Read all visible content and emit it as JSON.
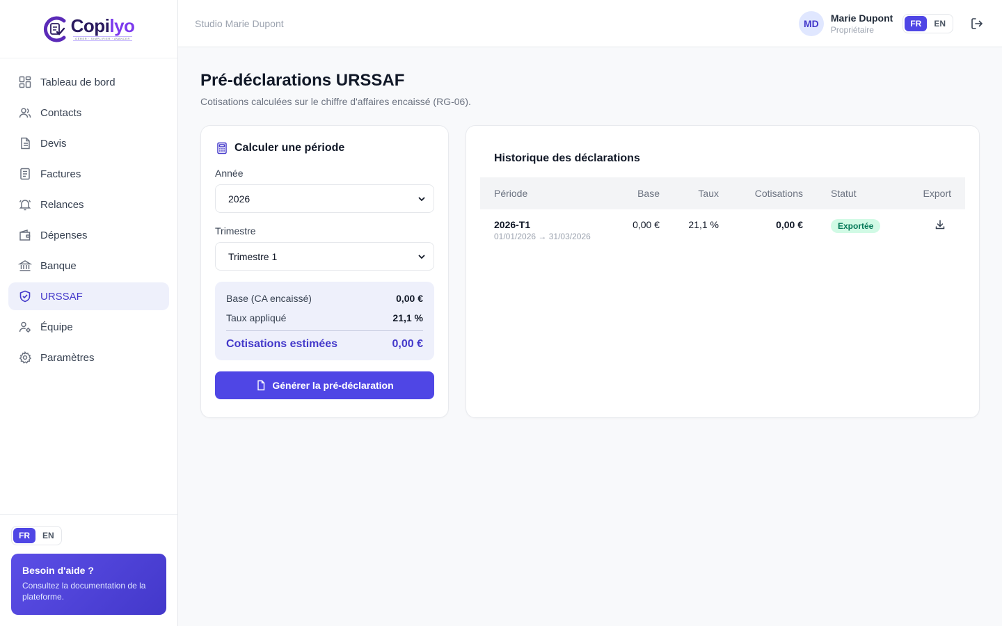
{
  "brand": {
    "name_part1": "Copi",
    "name_part2": "lyo",
    "tagline": "GÉRER · SIMPLIFIER · AVANCER"
  },
  "header": {
    "studio": "Studio Marie Dupont",
    "avatar": "MD",
    "user_name": "Marie Dupont",
    "user_role": "Propriétaire",
    "lang_fr": "FR",
    "lang_en": "EN"
  },
  "sidebar": {
    "items": [
      {
        "label": "Tableau de bord",
        "icon": "grid-icon"
      },
      {
        "label": "Contacts",
        "icon": "users-icon"
      },
      {
        "label": "Devis",
        "icon": "document-icon"
      },
      {
        "label": "Factures",
        "icon": "invoice-icon"
      },
      {
        "label": "Relances",
        "icon": "bell-icon"
      },
      {
        "label": "Dépenses",
        "icon": "wallet-icon"
      },
      {
        "label": "Banque",
        "icon": "bank-icon"
      },
      {
        "label": "URSSAF",
        "icon": "shield-icon"
      },
      {
        "label": "Équipe",
        "icon": "user-cog-icon"
      },
      {
        "label": "Paramètres",
        "icon": "settings-icon"
      }
    ],
    "active": "URSSAF",
    "lang_fr": "FR",
    "lang_en": "EN",
    "help_title": "Besoin d'aide ?",
    "help_text": "Consultez la documentation de la plateforme."
  },
  "page": {
    "title": "Pré-déclarations URSSAF",
    "subtitle": "Cotisations calculées sur le chiffre d'affaires encaissé (RG-06)."
  },
  "calc": {
    "title": "Calculer une période",
    "year_label": "Année",
    "year_value": "2026",
    "quarter_label": "Trimestre",
    "quarter_value": "Trimestre 1",
    "base_label": "Base (CA encaissé)",
    "base_value": "0,00 €",
    "rate_label": "Taux appliqué",
    "rate_value": "21,1 %",
    "total_label": "Cotisations estimées",
    "total_value": "0,00 €",
    "button": "Générer la pré-déclaration"
  },
  "history": {
    "title": "Historique des déclarations",
    "columns": [
      "Période",
      "Base",
      "Taux",
      "Cotisations",
      "Statut",
      "Export"
    ],
    "rows": [
      {
        "period": "2026-T1",
        "range": "01/01/2026 → 31/03/2026",
        "base": "0,00 €",
        "rate": "21,1 %",
        "contrib": "0,00 €",
        "status": "Exportée"
      }
    ]
  },
  "colors": {
    "accent": "#4f46e5",
    "accent_dark": "#4338ca",
    "active_bg": "#eef0fb",
    "badge_bg": "#d1fae5",
    "badge_text": "#047857"
  }
}
